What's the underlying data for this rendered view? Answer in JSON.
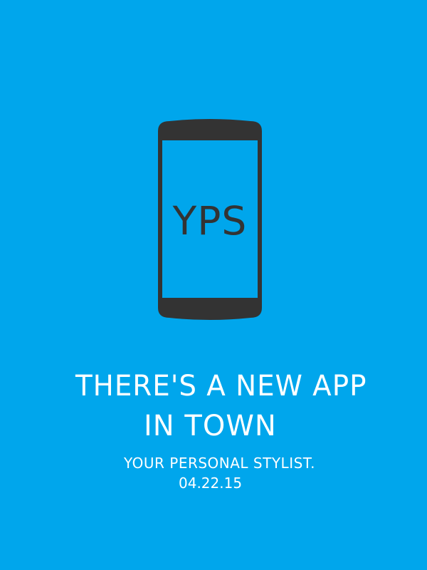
{
  "colors": {
    "background": "#00A6EC",
    "phone_body": "#333333",
    "phone_screen": "#00A6EC",
    "text": "#FFFFFF",
    "screen_text": "#333333"
  },
  "phone": {
    "icon": "smartphone-icon",
    "screen_text": "YPS"
  },
  "headline": {
    "line1": "THERE'S A NEW APP",
    "line2": "IN TOWN"
  },
  "tagline": "YOUR PERSONAL STYLIST.",
  "date": "04.22.15"
}
